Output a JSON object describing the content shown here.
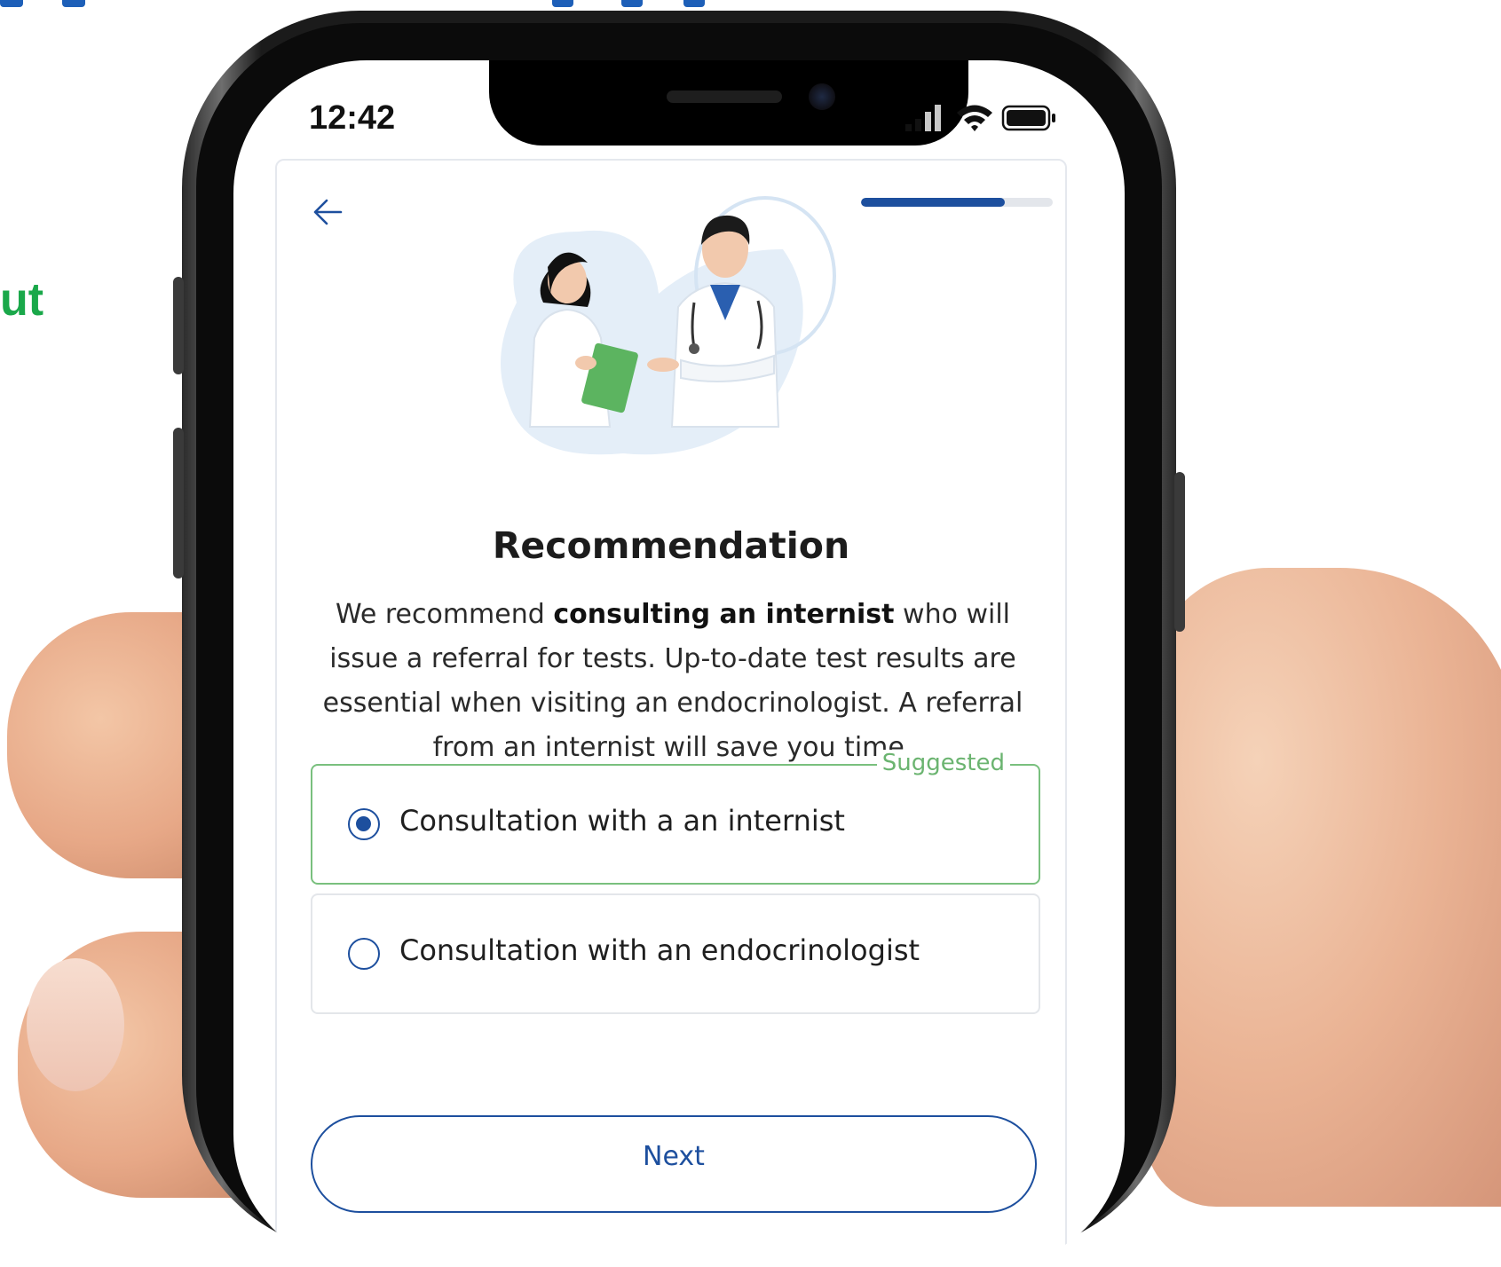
{
  "background_text": {
    "side_fragment": "ut"
  },
  "status_bar": {
    "time": "12:42",
    "icons": [
      "signal-icon",
      "wifi-icon",
      "battery-icon"
    ]
  },
  "header": {
    "back_icon": "arrow-left-icon",
    "progress": 0.75
  },
  "recommendation": {
    "title": "Recommendation",
    "desc_prefix": "We recommend ",
    "desc_bold": "consulting an internist",
    "desc_suffix": " who will issue a referral for tests. Up-to-date test results are essential when visiting an endocrinologist. A referral from an internist will save you time."
  },
  "options": [
    {
      "label": "Consultation with a an internist",
      "badge": "Suggested",
      "selected": true
    },
    {
      "label": "Consultation with an endocrinologist",
      "selected": false
    }
  ],
  "actions": {
    "next_label": "Next"
  },
  "colors": {
    "primary": "#1d4f9e",
    "suggested": "#6bb470",
    "side_text": "#1aa84a"
  }
}
